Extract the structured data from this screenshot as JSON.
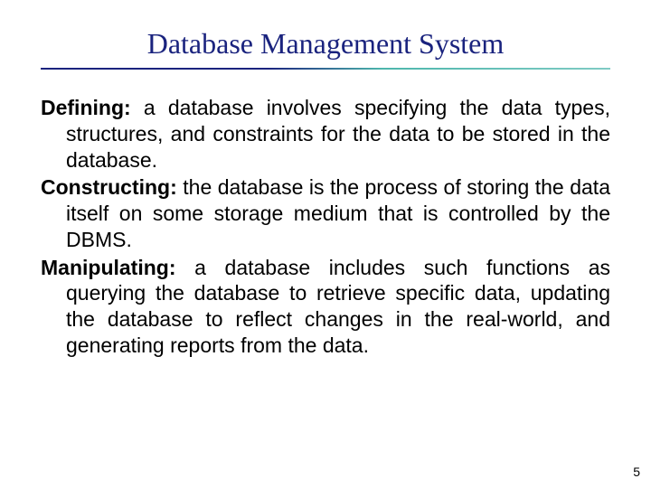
{
  "slide": {
    "title": "Database Management System",
    "paragraphs": [
      {
        "term": "Defining:",
        "text": " a database involves specifying the data types, structures, and constraints for the data to be stored in the database."
      },
      {
        "term": "Constructing:",
        "text": " the database is the process of storing the data itself on some storage medium that is controlled by the DBMS."
      },
      {
        "term": "Manipulating:",
        "text": " a database includes such functions as querying the database to retrieve specific data, updating the database to reflect changes in the real-world, and generating reports from the data."
      }
    ],
    "pageNumber": "5"
  }
}
